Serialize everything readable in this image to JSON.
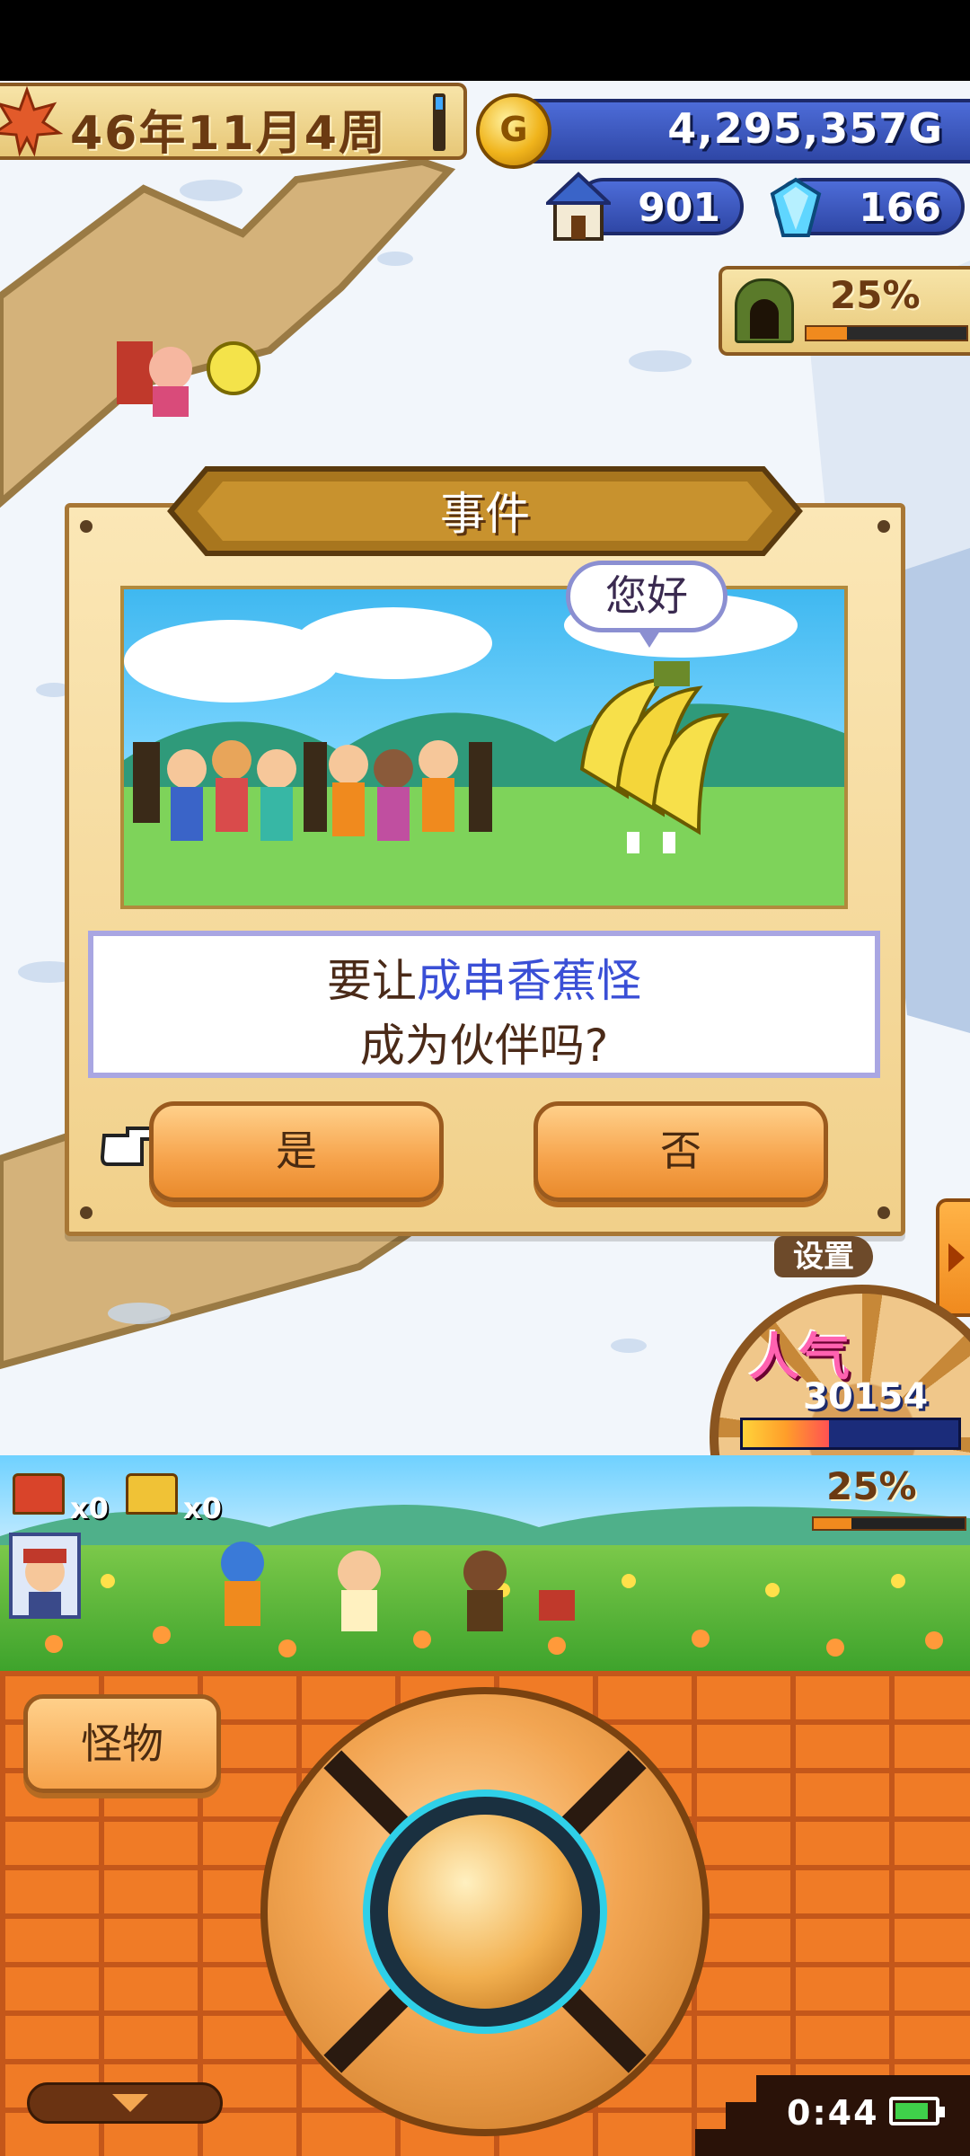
{
  "hud": {
    "date": "46年11月4周",
    "gold": "4,295,357G",
    "houses": "901",
    "gems": "166",
    "dungeon_percent": "25%",
    "dungeon_progress": 0.25
  },
  "event_dialog": {
    "title": "事件",
    "speech_bubble": "您好",
    "message_prefix": "要让",
    "monster_name": "成串香蕉怪",
    "message_line2": "成为伙伴吗?",
    "yes_label": "是",
    "no_label": "否"
  },
  "side": {
    "settings_label": "设置",
    "popularity_label": "人气",
    "popularity_value": "30154",
    "popularity_level": 0.4
  },
  "strip": {
    "red_chest_count": "x0",
    "gold_chest_count": "x0",
    "percent": "25%",
    "progress": 0.25
  },
  "controls": {
    "monster_button": "怪物",
    "clock": "0:44"
  },
  "icons": [
    "maple-leaf-icon",
    "gold-coin-icon",
    "house-icon",
    "crystal-icon",
    "cave-icon",
    "pointing-hand-icon",
    "red-chest-icon",
    "gold-chest-icon",
    "battery-icon"
  ],
  "colors": {
    "accent_blue": "#3a4fd6",
    "panel_gold": "#e7c777",
    "button_orange": "#f6a24a"
  }
}
